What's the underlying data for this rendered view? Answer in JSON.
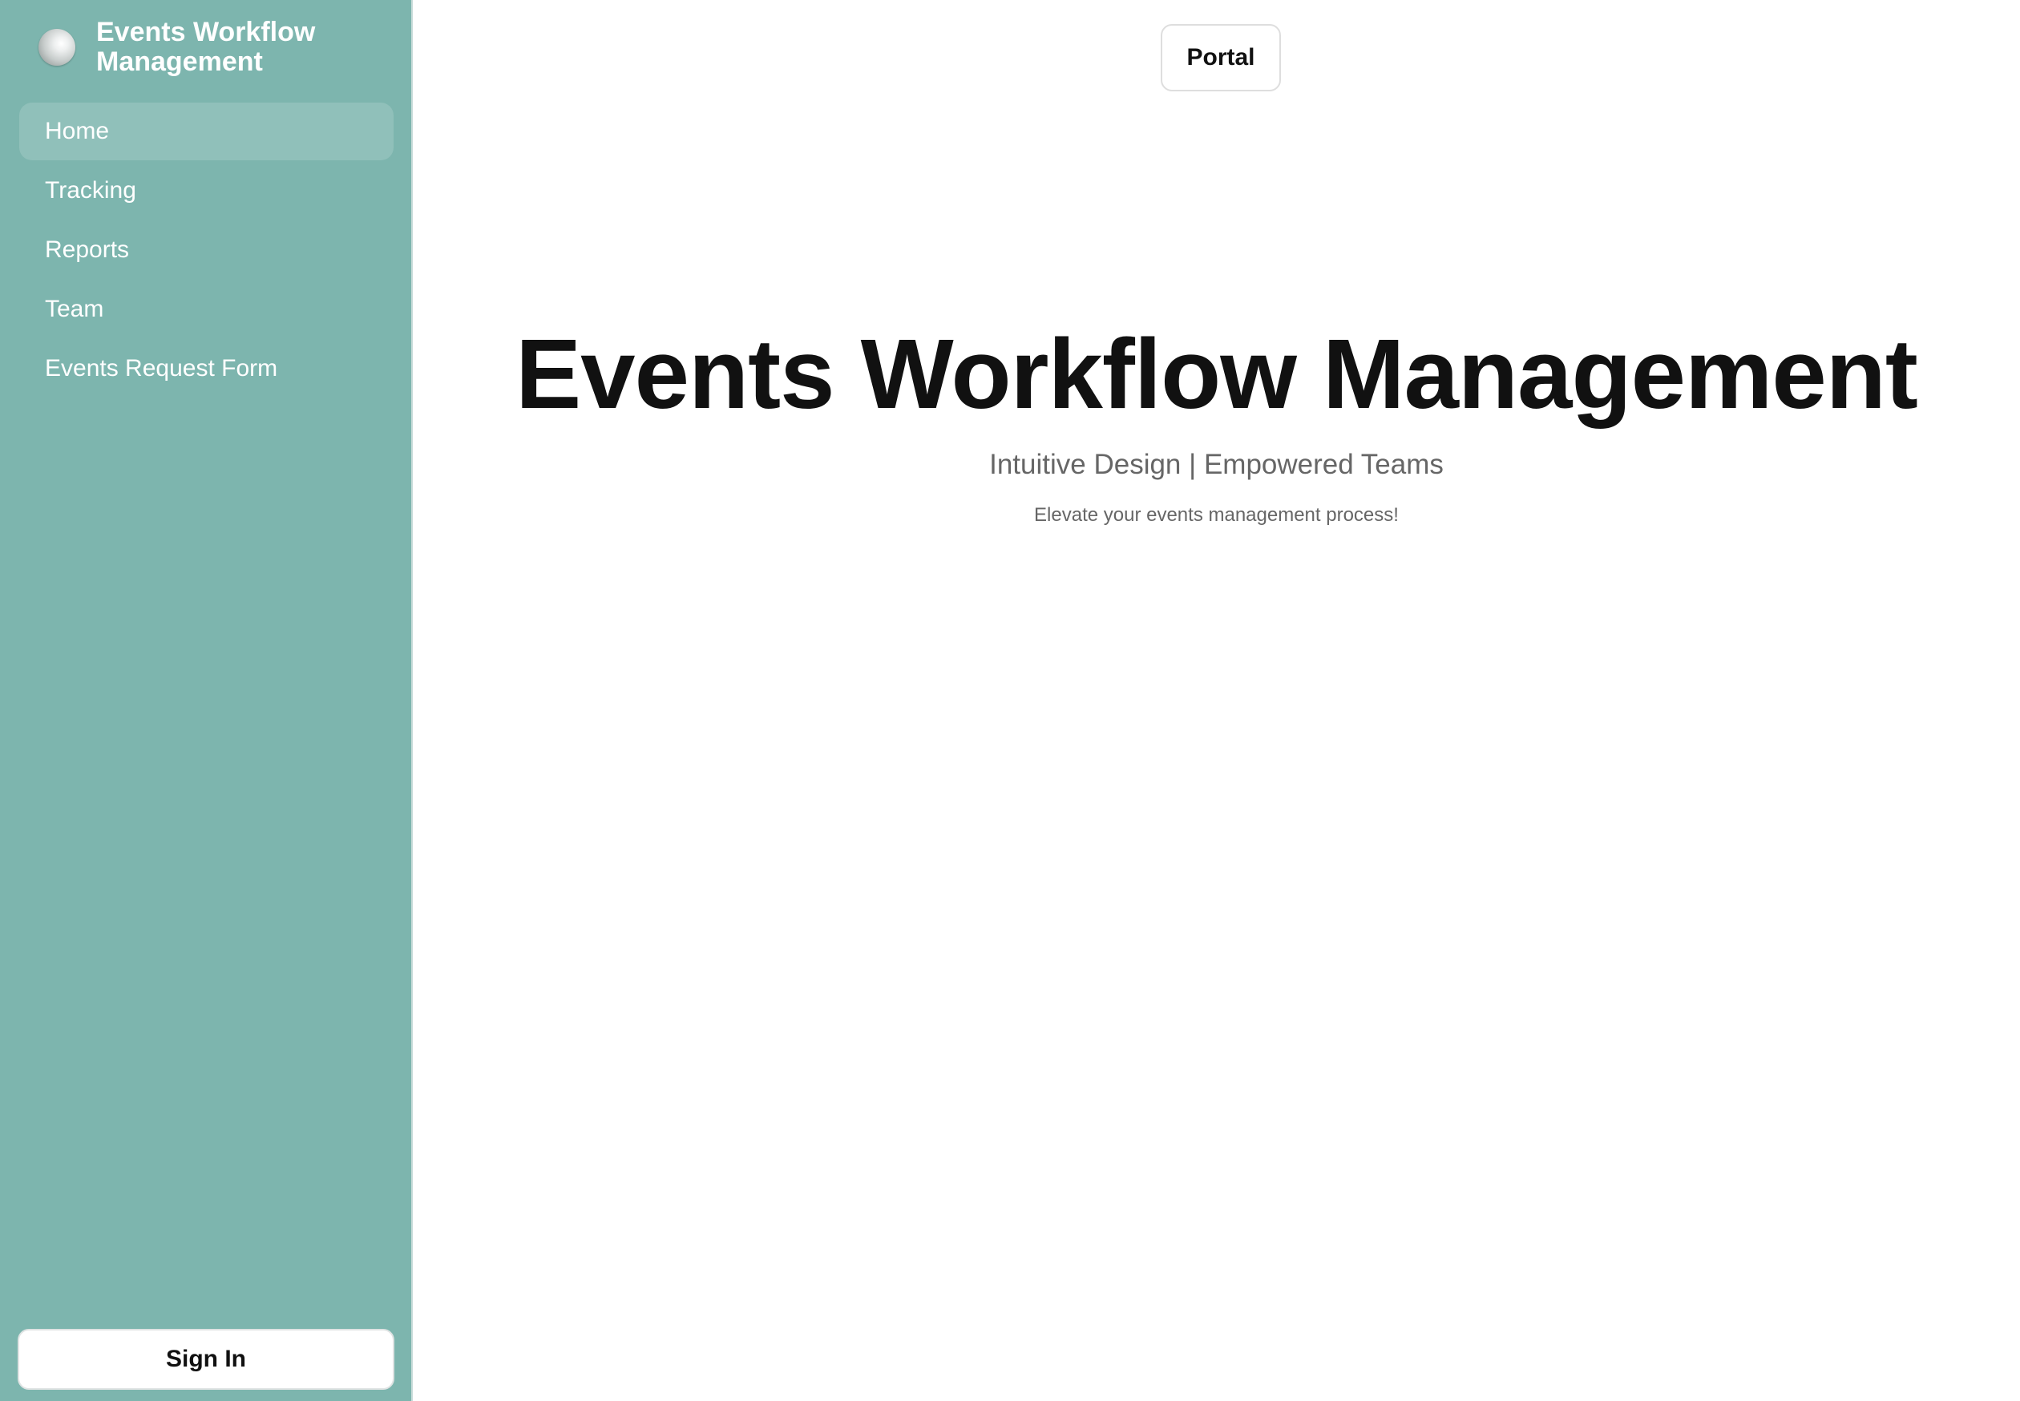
{
  "app": {
    "title": "Events Workflow Management"
  },
  "sidebar": {
    "items": [
      {
        "label": "Home",
        "active": true
      },
      {
        "label": "Tracking",
        "active": false
      },
      {
        "label": "Reports",
        "active": false
      },
      {
        "label": "Team",
        "active": false
      },
      {
        "label": "Events Request Form",
        "active": false
      }
    ],
    "signin_label": "Sign In"
  },
  "header": {
    "portal_label": "Portal"
  },
  "hero": {
    "title": "Events Workflow Management",
    "subtitle": "Intuitive Design | Empowered Teams",
    "tagline": "Elevate your events management process!"
  },
  "colors": {
    "sidebar_bg": "#7db5ae",
    "title_text": "#111111",
    "muted_text": "#666666"
  },
  "icons": {
    "brand_logo": "sphere-logo-icon"
  }
}
